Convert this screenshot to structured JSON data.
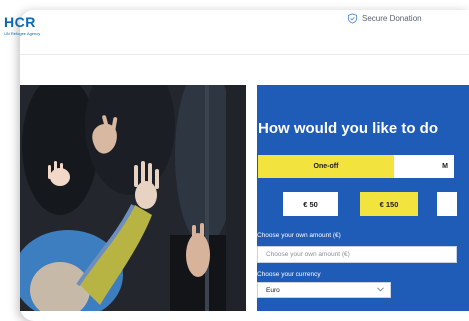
{
  "header": {
    "logo_text": "HCR",
    "logo_subtext": "UN Refugee Agency",
    "secure_label": "Secure Donation",
    "secure_icon": "shield-check-icon"
  },
  "hero": {
    "image_description_icon": "photo-children-hands"
  },
  "donation": {
    "heading": "How would you like to do",
    "frequency_tabs": [
      {
        "label": "One-off",
        "selected": true
      },
      {
        "label": "M",
        "selected": false
      }
    ],
    "amounts": [
      {
        "label": "€ 50",
        "selected": false
      },
      {
        "label": "€ 150",
        "selected": true
      },
      {
        "label": "",
        "selected": false
      }
    ],
    "own_amount_label": "Choose your own amount (€)",
    "own_amount_placeholder": "Choose your own amount (€)",
    "currency_label": "Choose your currency",
    "currency_value": "Euro"
  },
  "colors": {
    "brand_blue": "#1f5cb8",
    "accent_yellow": "#f3e33f",
    "logo_blue": "#0a67b4"
  }
}
